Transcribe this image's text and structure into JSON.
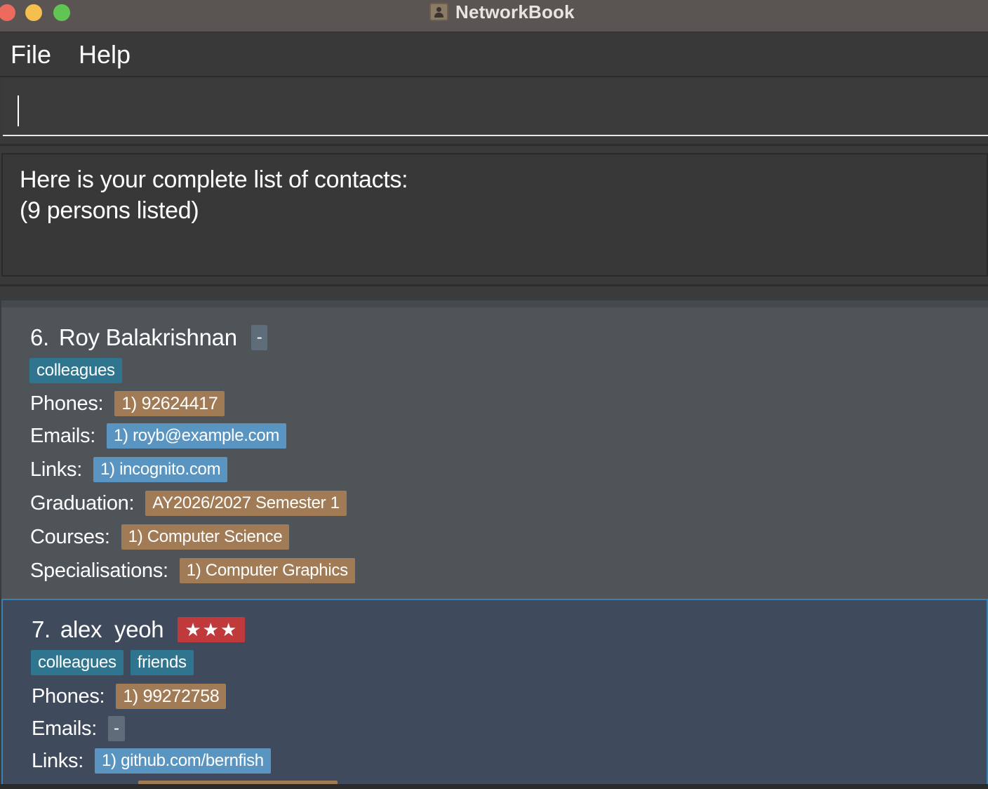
{
  "window": {
    "title": "NetworkBook"
  },
  "menu": {
    "file": "File",
    "help": "Help"
  },
  "command_box": {
    "value": "",
    "placeholder": ""
  },
  "result": {
    "line1": "Here is your complete list of contacts:",
    "line2": "(9 persons listed)"
  },
  "persons": [
    {
      "index": "6.",
      "name": "Roy Balakrishnan",
      "priority": "-",
      "tags": [
        "colleagues"
      ],
      "phones_label": "Phones:",
      "phones": [
        "1) 92624417"
      ],
      "emails_label": "Emails:",
      "emails": [
        "1) royb@example.com"
      ],
      "links_label": "Links:",
      "links": [
        "1) incognito.com"
      ],
      "graduation_label": "Graduation:",
      "graduation": "AY2026/2027 Semester 1",
      "courses_label": "Courses:",
      "courses": [
        "1) Computer Science"
      ],
      "specialisations_label": "Specialisations:",
      "specialisations": [
        "1) Computer Graphics"
      ]
    },
    {
      "index": "7.",
      "name": "alex  yeoh",
      "priority": "★★★",
      "tags": [
        "colleagues",
        "friends"
      ],
      "phones_label": "Phones:",
      "phones": [
        "1) 99272758"
      ],
      "emails_label": "Emails:",
      "emails": [
        "-"
      ],
      "links_label": "Links:",
      "links": [
        "1) github.com/bernfish"
      ]
    }
  ],
  "colors": {
    "tag": "#2f7590",
    "phone": "#a07b55",
    "email": "#5a95c2",
    "priority_high": "#c0393b",
    "selected_border": "#3c7fb0"
  }
}
